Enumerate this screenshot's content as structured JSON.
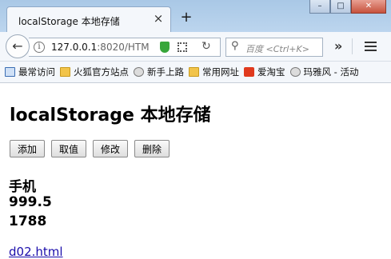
{
  "browser": {
    "tab_title": "localStorage 本地存储",
    "tab_close_glyph": "×",
    "new_tab_glyph": "+",
    "url_host": "127.0.0.1",
    "url_rest": ":8020/HTM",
    "search_placeholder": "百度 <Ctrl+K>",
    "overflow_glyph": "»",
    "window_buttons": {
      "minimize": "–",
      "maximize": "□",
      "close": "✕"
    }
  },
  "bookmarks": [
    {
      "label": "最常访问",
      "icon": "bookmark-icon"
    },
    {
      "label": "火狐官方站点",
      "icon": "folder-icon"
    },
    {
      "label": "新手上路",
      "icon": "globe-icon"
    },
    {
      "label": "常用网址",
      "icon": "folder-icon"
    },
    {
      "label": "爱淘宝",
      "icon": "taobao-icon"
    },
    {
      "label": "玛雅风 - 活动",
      "icon": "globe-icon"
    }
  ],
  "page": {
    "title": "localStorage 本地存储",
    "buttons": {
      "add": "添加",
      "get": "取值",
      "edit": "修改",
      "delete": "删除"
    },
    "outputs": [
      "手机",
      "999.5",
      "1788"
    ],
    "link": "d02.html"
  }
}
